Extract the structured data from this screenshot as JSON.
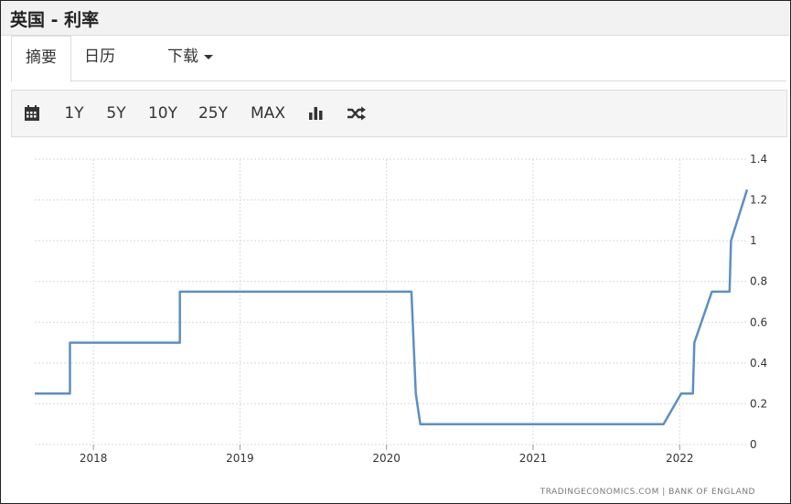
{
  "title": "英国 - 利率",
  "tabs": [
    {
      "label": "摘要",
      "active": true
    },
    {
      "label": "日历",
      "active": false
    },
    {
      "label": "下载",
      "active": false
    }
  ],
  "toolbar": {
    "calendar_icon": "calendar-icon",
    "ranges": [
      "1Y",
      "5Y",
      "10Y",
      "25Y",
      "MAX"
    ],
    "bar_chart_icon": "bar-chart-icon",
    "shuffle_icon": "shuffle-icon"
  },
  "credit": "TRADINGECONOMICS.COM | BANK OF ENGLAND",
  "colors": {
    "line": "#5b8fc4",
    "grid": "#d9d9d9"
  },
  "chart_data": {
    "type": "line",
    "title": "",
    "xlabel": "",
    "ylabel": "",
    "ylim": [
      0,
      1.4
    ],
    "yticks": [
      0,
      0.2,
      0.4,
      0.6,
      0.8,
      1,
      1.2,
      1.4
    ],
    "ytick_labels": [
      "0",
      "0.2",
      "0.4",
      "0.6",
      "0.8",
      "1",
      "1.2",
      "1.4"
    ],
    "xlim": [
      2017.6,
      2022.46
    ],
    "xticks": [
      2018,
      2019,
      2020,
      2021,
      2022
    ],
    "xtick_labels": [
      "2018",
      "2019",
      "2020",
      "2021",
      "2022"
    ],
    "grid": true,
    "y_axis_side": "right",
    "series": [
      {
        "x": [
          2017.6,
          2017.84,
          2017.84,
          2018.59,
          2018.59,
          2020.17,
          2020.2,
          2020.23,
          2021.89,
          2022.01,
          2022.09,
          2022.1,
          2022.22,
          2022.34,
          2022.35,
          2022.46
        ],
        "y": [
          0.25,
          0.25,
          0.5,
          0.5,
          0.75,
          0.75,
          0.25,
          0.1,
          0.1,
          0.25,
          0.25,
          0.5,
          0.75,
          0.75,
          1.0,
          1.25
        ]
      }
    ]
  }
}
